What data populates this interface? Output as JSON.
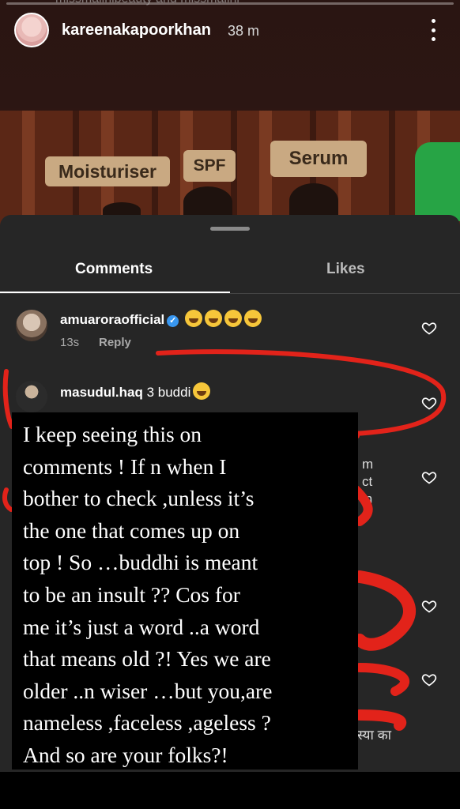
{
  "story": {
    "username": "kareenakapoorkhan",
    "time": "38 m",
    "top_partial_text": "missmalinibeauty and missmalini",
    "tags": [
      "Moisturiser",
      "SPF",
      "Serum"
    ]
  },
  "sheet": {
    "tabs": [
      {
        "label": "Comments",
        "active": true
      },
      {
        "label": "Likes",
        "active": false
      }
    ]
  },
  "comments": [
    {
      "username": "amuaroraofficial",
      "verified": true,
      "text": "",
      "emoji_count": 4,
      "time": "13s",
      "reply": "Reply"
    },
    {
      "username": "masudul.haq",
      "verified": false,
      "text": "3 buddi",
      "emoji_count": 1
    }
  ],
  "partial_snippets": {
    "right_1": "m",
    "right_2": "ct",
    "right_3": "in",
    "bottom_right": "स्या का"
  },
  "overlay": {
    "text": "I keep seeing this on\ncomments ! If n when I\nbother to check ,unless it’s\nthe one that comes up on\ntop ! So …buddhi is meant\nto be an insult ?? Cos for\nme it’s just a word ..a word\nthat means old ?! Yes we are\nolder ..n wiser …but you,are\nnameless ,faceless ,ageless ?\nAnd so are your folks?!"
  },
  "colors": {
    "annotation_red": "#e2231a",
    "sheet_bg": "#262626",
    "verified_blue": "#3897f0"
  },
  "icons": [
    "more-icon",
    "heart-icon",
    "verified-badge-icon",
    "laughing-emoji-icon"
  ]
}
